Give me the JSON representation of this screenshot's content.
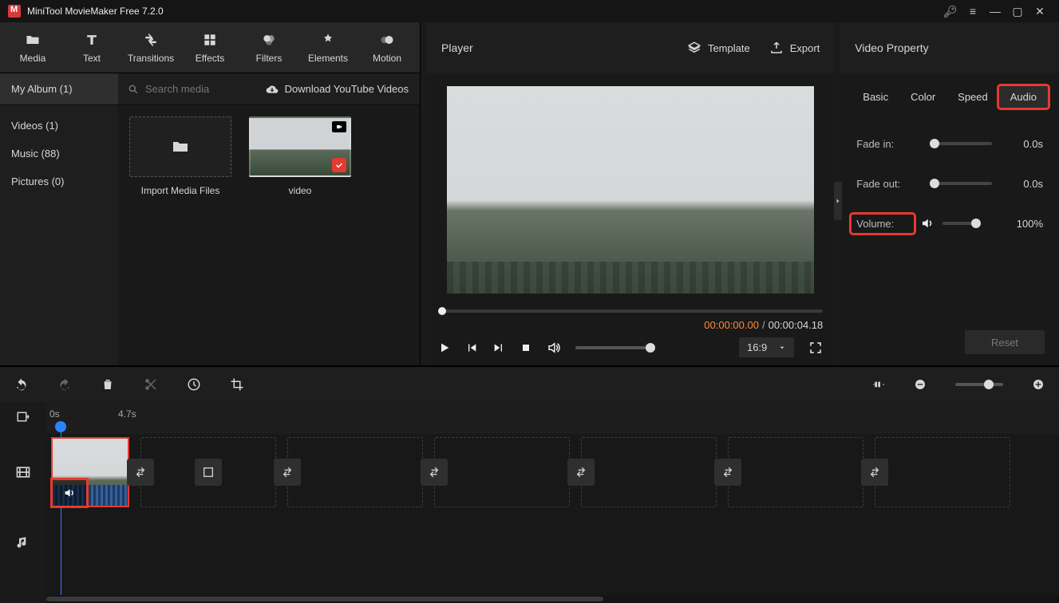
{
  "titlebar": {
    "title": "MiniTool MovieMaker Free 7.2.0"
  },
  "tabs": [
    {
      "label": "Media",
      "active": true
    },
    {
      "label": "Text"
    },
    {
      "label": "Transitions"
    },
    {
      "label": "Effects"
    },
    {
      "label": "Filters"
    },
    {
      "label": "Elements"
    },
    {
      "label": "Motion"
    }
  ],
  "sidebar": {
    "header": "My Album (1)",
    "items": [
      {
        "label": "Videos (1)"
      },
      {
        "label": "Music (88)"
      },
      {
        "label": "Pictures (0)"
      }
    ]
  },
  "search": {
    "placeholder": "Search media"
  },
  "download_label": "Download YouTube Videos",
  "media": {
    "import_label": "Import Media Files",
    "clip_label": "video"
  },
  "player": {
    "title": "Player",
    "template": "Template",
    "export": "Export",
    "time_current": "00:00:00.00",
    "time_total": "00:00:04.18",
    "aspect": "16:9"
  },
  "props": {
    "title": "Video Property",
    "tabs": [
      "Basic",
      "Color",
      "Speed",
      "Audio"
    ],
    "fade_in_label": "Fade in:",
    "fade_in_value": "0.0s",
    "fade_out_label": "Fade out:",
    "fade_out_value": "0.0s",
    "volume_label": "Volume:",
    "volume_value": "100%",
    "reset": "Reset"
  },
  "timeline": {
    "ruler": [
      "0s",
      "4.7s"
    ]
  }
}
